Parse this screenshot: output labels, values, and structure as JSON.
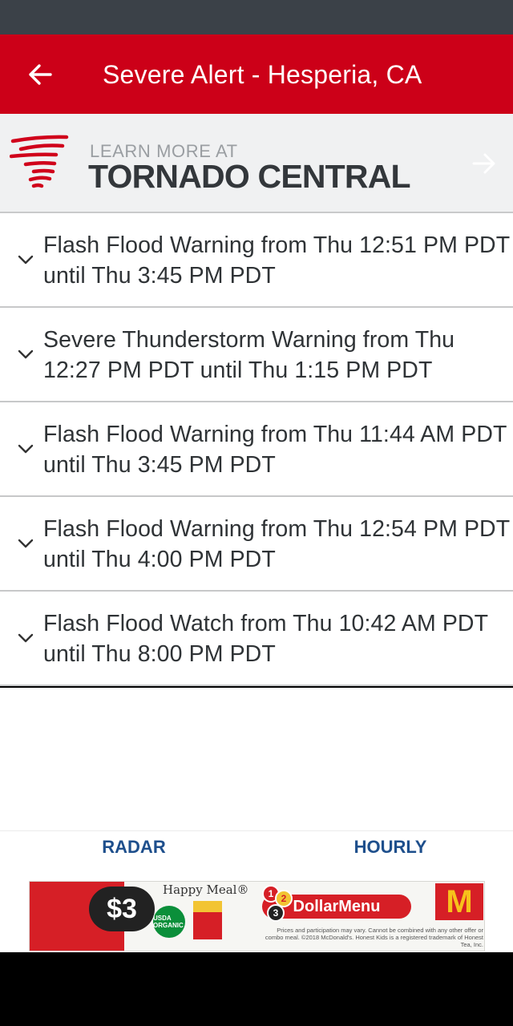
{
  "app_bar": {
    "title": "Severe Alert - Hesperia, CA",
    "back_icon": "arrow-left-icon",
    "background_color": "#cc0018"
  },
  "promo": {
    "learn_more": "LEARN MORE AT",
    "brand": "TORNADO CENTRAL",
    "logo_icon": "tornado-icon",
    "arrow_icon": "arrow-right-icon"
  },
  "alerts": [
    {
      "text": "Flash Flood Warning from Thu 12:51 PM PDT until Thu 3:45 PM PDT"
    },
    {
      "text": "Severe Thunderstorm Warning from Thu 12:27 PM PDT until Thu 1:15 PM PDT"
    },
    {
      "text": "Flash Flood Warning from Thu 11:44 AM PDT until Thu 3:45 PM PDT"
    },
    {
      "text": "Flash Flood Warning from Thu 12:54 PM PDT until Thu 4:00 PM PDT"
    },
    {
      "text": "Flash Flood Watch from Thu 10:42 AM PDT until Thu 8:00 PM PDT"
    }
  ],
  "tabs": {
    "radar": "RADAR",
    "hourly": "HOURLY",
    "color": "#1e4f8c"
  },
  "ad": {
    "happy_meal": "Happy Meal®",
    "price": "$3",
    "usda": "USDA ORGANIC",
    "dollar_menu": "DollarMenu",
    "badge_1": "1",
    "badge_2": "2",
    "badge_3": "3",
    "fine_print": "Prices and participation may vary. Cannot be combined with any other offer or combo meal. ©2018 McDonald's. Honest Kids is a registered trademark of Honest Tea, Inc.",
    "logo": "M"
  }
}
